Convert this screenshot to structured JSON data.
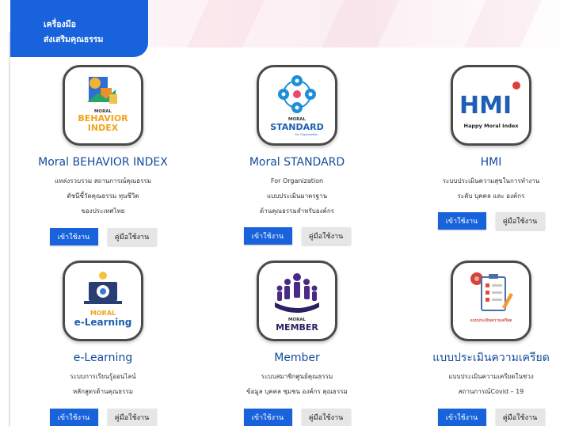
{
  "header": {
    "line1": "เครื่องมือ",
    "line2": "ส่งเสริมคุณธรรม"
  },
  "colors": {
    "primary": "#1863dc",
    "title": "#124c9b",
    "secondary_button": "#e6e6e6"
  },
  "cards": [
    {
      "title": "Moral BEHAVIOR INDEX",
      "icon": "moral-behavior-index-logo",
      "logo_text": [
        "MORAL",
        "BEHAVIOR",
        "INDEX"
      ],
      "desc": [
        "แหล่งรวบรวม สถานการณ์คุณธรรม",
        "ดัชนีชี้วัดคุณธรรม ทุนชีวิต",
        "ของประเทศไทย"
      ],
      "enter_label": "เข้าใช้งาน",
      "manual_label": "คู่มือใช้งาน"
    },
    {
      "title": "Moral STANDARD",
      "icon": "moral-standard-logo",
      "logo_text": [
        "MORAL",
        "STANDARD",
        "For Organization"
      ],
      "desc": [
        "For Organization",
        "แบบประเมินมาตรฐาน",
        "ด้านคุณธรรมสำหรับองค์กร"
      ],
      "enter_label": "เข้าใช้งาน",
      "manual_label": "คู่มือใช้งาน"
    },
    {
      "title": "HMI",
      "icon": "happy-moral-index-logo",
      "logo_text": [
        "HMI",
        "Happy Moral Index"
      ],
      "desc": [
        "ระบบประเมินความสุขในการทำงาน",
        "ระดับ บุคคล และ องค์กร"
      ],
      "enter_label": "เข้าใช้งาน",
      "manual_label": "คู่มือใช้งาน"
    },
    {
      "title": "e-Learning",
      "icon": "moral-elearning-logo",
      "logo_text": [
        "MORAL",
        "e-Learning"
      ],
      "desc": [
        "ระบบการเรียนรู้ออนไลน์",
        "หลักสูตรด้านคุณธรรม"
      ],
      "enter_label": "เข้าใช้งาน",
      "manual_label": "คู่มือใช้งาน"
    },
    {
      "title": "Member",
      "icon": "moral-member-logo",
      "logo_text": [
        "MORAL",
        "MEMBER"
      ],
      "desc": [
        "ระบบสมาชิกศูนย์คุณธรรม",
        "ข้อมูล บุคคล ชุมชน องค์กร คุณธรรม"
      ],
      "enter_label": "เข้าใช้งาน",
      "manual_label": "คู่มือใช้งาน"
    },
    {
      "title": "แบบประเมินความเครียด",
      "icon": "stress-assessment-logo",
      "logo_text": [
        "แบบประเมินความเครียด"
      ],
      "desc": [
        "แบบประเมินความเครียดในช่วง",
        "สถานการณ์Covid – 19"
      ],
      "enter_label": "เข้าใช้งาน",
      "manual_label": "คู่มือใช้งาน"
    }
  ]
}
